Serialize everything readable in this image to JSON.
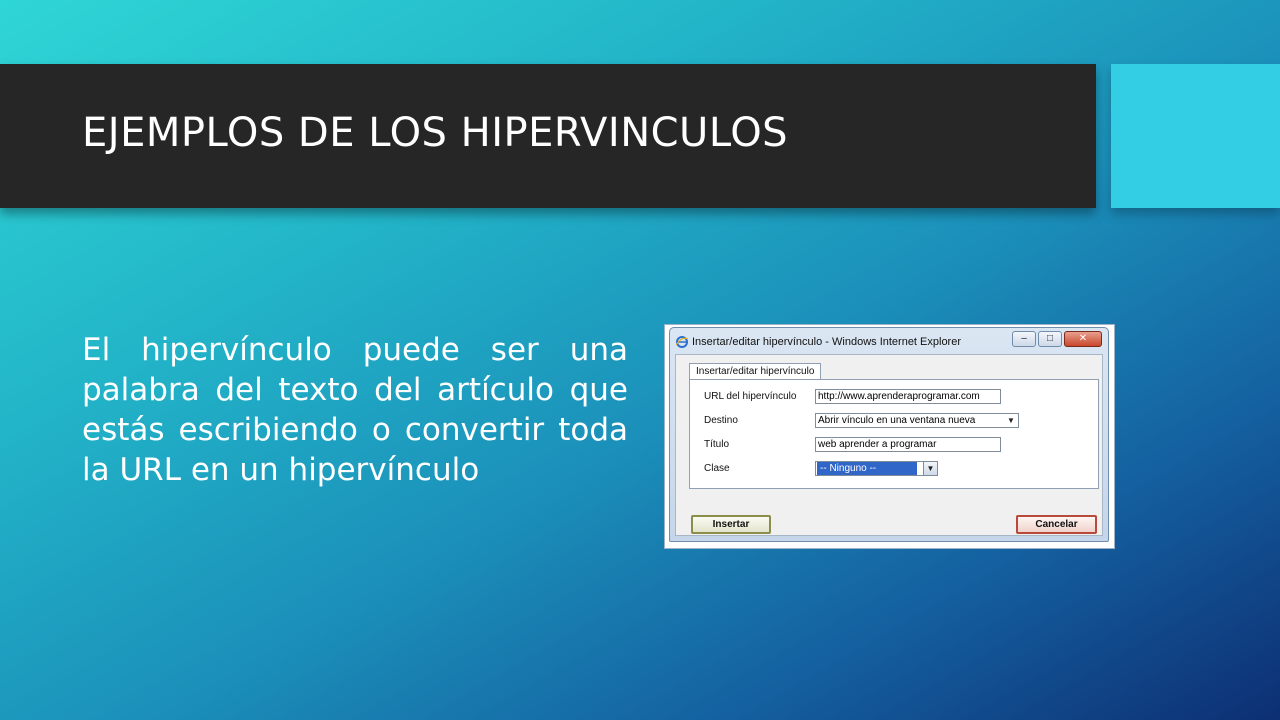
{
  "slide": {
    "title": "EJEMPLOS DE LOS HIPERVINCULOS",
    "body": "El hipervínculo puede ser una palabra del texto del artículo que estás escribiendo o convertir toda la URL en un hipervínculo"
  },
  "dialog": {
    "window_title": "Insertar/editar hipervínculo - Windows Internet Explorer",
    "tab_label": "Insertar/editar hipervínculo",
    "fields": {
      "url_label": "URL del hipervínculo",
      "url_value": "http://www.aprenderaprogramar.com",
      "target_label": "Destino",
      "target_value": "Abrir vínculo en una ventana nueva",
      "title_label": "Título",
      "title_value": "web aprender a programar",
      "class_label": "Clase",
      "class_value": "-- Ninguno --"
    },
    "insert_label": "Insertar",
    "cancel_label": "Cancelar",
    "window_buttons": {
      "minimize": "–",
      "maximize": "□",
      "close": "✕"
    }
  },
  "colors": {
    "title_bar": "#262626",
    "accent_block": "#33cde4",
    "background_start": "#2fd6d6",
    "background_end": "#0d2f73"
  }
}
